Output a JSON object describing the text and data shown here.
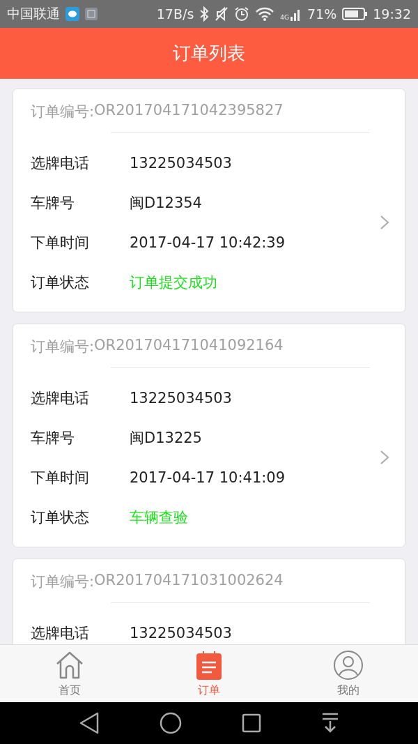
{
  "status_bar": {
    "carrier": "中国联通",
    "speed": "17B/s",
    "network": "4G",
    "battery": "71%",
    "time": "19:32"
  },
  "header": {
    "title": "订单列表"
  },
  "orders": [
    {
      "number_label": "订单编号:",
      "number": "OR201704171042395827",
      "arrow": true,
      "fields": [
        {
          "label": "选牌电话",
          "value": "13225034503",
          "kind": "plain"
        },
        {
          "label": "车牌号",
          "value": "闽D12354",
          "kind": "plain"
        },
        {
          "label": "下单时间",
          "value": "2017-04-17 10:42:39",
          "kind": "plain"
        },
        {
          "label": "订单状态",
          "value": "订单提交成功",
          "kind": "status"
        }
      ]
    },
    {
      "number_label": "订单编号:",
      "number": "OR201704171041092164",
      "arrow": true,
      "fields": [
        {
          "label": "选牌电话",
          "value": "13225034503",
          "kind": "plain"
        },
        {
          "label": "车牌号",
          "value": "闽D13225",
          "kind": "plain"
        },
        {
          "label": "下单时间",
          "value": "2017-04-17 10:41:09",
          "kind": "plain"
        },
        {
          "label": "订单状态",
          "value": "车辆查验",
          "kind": "status"
        }
      ]
    },
    {
      "number_label": "订单编号:",
      "number": "OR201704171031002624",
      "fields": [
        {
          "label": "选牌电话",
          "value": "13225034503",
          "kind": "plain"
        }
      ]
    }
  ],
  "tabs": [
    {
      "label": "首页",
      "kind": "home",
      "selected": false
    },
    {
      "label": "订单",
      "kind": "orders",
      "selected": true
    },
    {
      "label": "我的",
      "kind": "profile",
      "selected": false
    }
  ]
}
